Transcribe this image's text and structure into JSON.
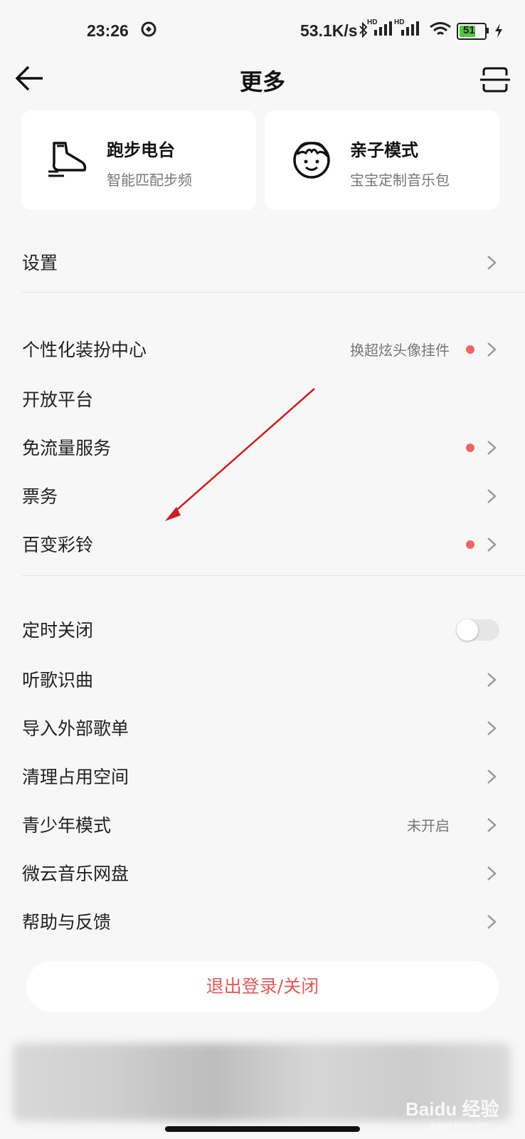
{
  "status_bar": {
    "time": "23:26",
    "net_speed": "53.1K/s",
    "signal_1_label": "HD",
    "signal_2_label": "HD",
    "battery_level": "51"
  },
  "header": {
    "title": "更多"
  },
  "feature_cards": [
    {
      "title": "跑步电台",
      "subtitle": "智能匹配步频",
      "icon": "running-shoe-icon"
    },
    {
      "title": "亲子模式",
      "subtitle": "宝宝定制音乐包",
      "icon": "baby-face-icon"
    }
  ],
  "settings_row": {
    "label": "设置"
  },
  "group2": [
    {
      "label": "个性化装扮中心",
      "hint": "换超炫头像挂件",
      "dot": true
    },
    {
      "label": "开放平台"
    },
    {
      "label": "免流量服务",
      "dot": true
    },
    {
      "label": "票务"
    },
    {
      "label": "百变彩铃",
      "dot": true
    }
  ],
  "group3": {
    "timer": {
      "label": "定时关闭",
      "toggle_on": false
    },
    "items": [
      {
        "label": "听歌识曲"
      },
      {
        "label": "导入外部歌单"
      },
      {
        "label": "清理占用空间"
      },
      {
        "label": "青少年模式",
        "hint": "未开启"
      },
      {
        "label": "微云音乐网盘"
      },
      {
        "label": "帮助与反馈"
      }
    ]
  },
  "logout": {
    "label": "退出登录/关闭"
  },
  "watermark": {
    "text": "Baidu 经验",
    "subtext": "jingyan.baidu.com"
  },
  "colors": {
    "accent_red": "#f06464",
    "logout_text": "#e05a5a",
    "annotation_arrow": "#cc1f1f"
  }
}
